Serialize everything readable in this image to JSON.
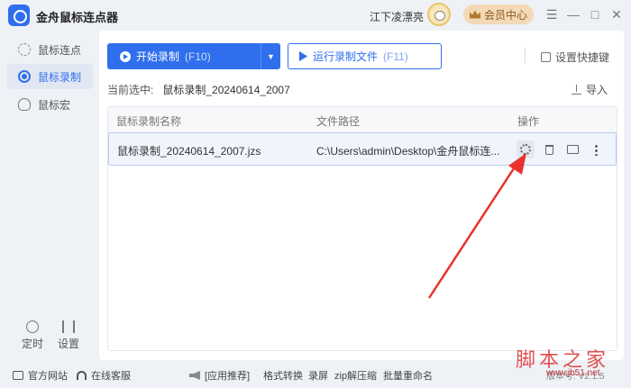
{
  "app": {
    "title": "金舟鼠标连点器"
  },
  "header": {
    "user_name": "江下凌漂亮",
    "vip_label": "会员中心",
    "menu_icon": "☰",
    "minimize_icon": "—",
    "maximize_icon": "□",
    "close_icon": "✕"
  },
  "sidebar": {
    "items": [
      {
        "label": "鼠标连点",
        "icon": "click-icon"
      },
      {
        "label": "鼠标录制",
        "icon": "record-icon"
      },
      {
        "label": "鼠标宏",
        "icon": "mouse-icon"
      }
    ],
    "bottom": [
      {
        "label": "定时",
        "icon": "timer-icon"
      },
      {
        "label": "设置",
        "icon": "settings-icon"
      }
    ]
  },
  "toolbar": {
    "start_label": "开始录制",
    "start_hotkey": "(F10)",
    "run_label": "运行录制文件",
    "run_hotkey": "(F11)",
    "hotkey_label": "设置快捷键",
    "import_label": "导入"
  },
  "current": {
    "label": "当前选中:",
    "value": "鼠标录制_20240614_2007"
  },
  "table": {
    "columns": [
      "鼠标录制名称",
      "文件路径",
      "操作"
    ],
    "rows": [
      {
        "name": "鼠标录制_20240614_2007.jzs",
        "path": "C:\\Users\\admin\\Desktop\\金舟鼠标连..."
      }
    ]
  },
  "statusbar": {
    "website": "官方网站",
    "support": "在线客服",
    "promo_tag": "[应用推荐]",
    "promo_items": [
      "格式转换",
      "录屏",
      "zip解压缩",
      "批量重命名"
    ],
    "version": "版本号: V2.1.5"
  },
  "watermark": {
    "text": "脚本之家",
    "url": "www.jb51.net"
  },
  "colors": {
    "accent": "#2f6fed",
    "arrow": "#e8322f"
  }
}
